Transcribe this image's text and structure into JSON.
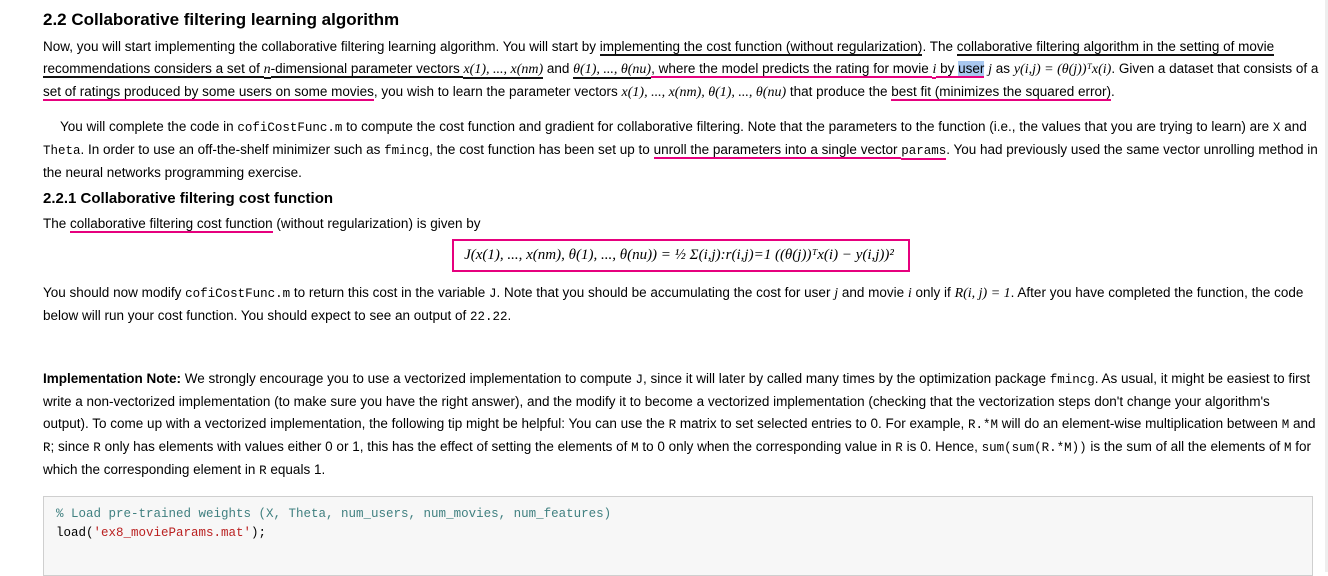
{
  "section": {
    "title": "2.2 Collaborative filtering learning algorithm"
  },
  "intro": {
    "s1": "Now, you will start implementing the collaborative filtering learning algorithm. You will start by ",
    "u1": "implementing the cost function (without regularization)",
    "s2": ". The ",
    "u2": "collaborative filtering algorithm in the setting of movie recommendations considers a set of ",
    "n": "n",
    "s3": "-dimensional parameter vectors ",
    "xvec": "x(1), ..., x(nm)",
    "and1": " and ",
    "thetavec": "θ(1), ..., θ(nu)",
    "s4": ", where the model predicts the rating for movie ",
    "i": "i",
    "s5": " by ",
    "user": "user",
    "j": "j",
    "s6": " as ",
    "ypred": "y(i,j) = (θ(j))ᵀx(i)",
    "s7": ". Given a dataset that consists of a ",
    "u3": "set of ratings produced by some users on some movies",
    "s8": ", you wish to learn the parameter vectors ",
    "params": "x(1), ..., x(nm), θ(1), ..., θ(nu)",
    "s9": " that produce the ",
    "u4": "best fit (minimizes the squared error)",
    "s10": "."
  },
  "para2": {
    "s1": "You will complete the code in ",
    "file": "cofiCostFunc.m",
    "s2": " to compute the cost function and gradient for collaborative filtering. Note that the parameters to the function (i.e., the values that you are trying to learn) are ",
    "X": "X",
    "and": " and ",
    "Theta": "Theta",
    "s3": ". In order to use an off-the-shelf minimizer such as ",
    "fmincg": "fmincg",
    "s4": ", the cost function has been set up to ",
    "u1": "unroll the parameters into a single vector ",
    "params": "params",
    "s5": ". You had previously used the same vector unrolling method in the neural networks programming exercise."
  },
  "subsection": {
    "title": "2.2.1 Collaborative filtering cost function"
  },
  "para3": {
    "s1": "The ",
    "u1": "collaborative filtering cost function",
    "s2": " (without regularization) is given by"
  },
  "formula": {
    "text": "J(x(1), ..., x(nm), θ(1), ..., θ(nu)) = ½ Σ(i,j):r(i,j)=1 ((θ(j))ᵀx(i) − y(i,j))²"
  },
  "para4": {
    "s1": "You should now modify ",
    "file": "cofiCostFunc.m",
    "s2": " to return this cost in the variable ",
    "J": "J",
    "s3": ". Note that you should be accumulating the cost for user ",
    "j": "j",
    "s4": " and movie ",
    "i": "i",
    "s5": " only if ",
    "cond": "R(i, j) = 1",
    "s6": ". After you have completed the function, the code below will run your cost function. You should expect to see an output of ",
    "value": "22.22",
    "s7": "."
  },
  "impl": {
    "label": "Implementation Note:",
    "s1": " We strongly encourage you to use a vectorized implementation to compute ",
    "J": "J",
    "s2": ", since it will later by called many times by the optimization package ",
    "fmincg": "fmincg",
    "s3": ". As usual, it might be easiest to first write a non-vectorized implementation (to make sure you have the right answer), and the modify it to become a vectorized implementation (checking that the vectorization steps don't change your algorithm's output). To come up with a vectorized implementation, the following tip might be helpful: You can use the ",
    "R": "R",
    "s4": " matrix to set selected entries to 0. For example, ",
    "RM": "R.*M",
    "s5": " will do an element-wise multiplication between ",
    "M": "M",
    "and": " and ",
    "R2": "R",
    "s6": "; since ",
    "R3": "R",
    "s7": " only has elements with values either 0 or 1, this has the effect of setting the elements of ",
    "M2": "M",
    "s8": " to 0 only when the corresponding value in ",
    "R4": "R",
    "s9": " is 0. Hence, ",
    "sumexpr": "sum(sum(R.*M))",
    "s10": " is the sum of all the elements of ",
    "M3": "M",
    "s11": " for which the corresponding element in ",
    "R5": "R",
    "s12": " equals 1."
  },
  "code": {
    "line1": "%  Load pre-trained weights (X, Theta, num_users, num_movies, num_features)",
    "line2_fn": "load(",
    "line2_str": "'ex8_movieParams.mat'",
    "line2_end": ");"
  },
  "colors": {
    "annotation_pink": "#e6007e",
    "annotation_dark": "#111111",
    "selection_highlight": "#a8c8f0",
    "code_comment": "#408080",
    "code_string": "#ba2121"
  }
}
